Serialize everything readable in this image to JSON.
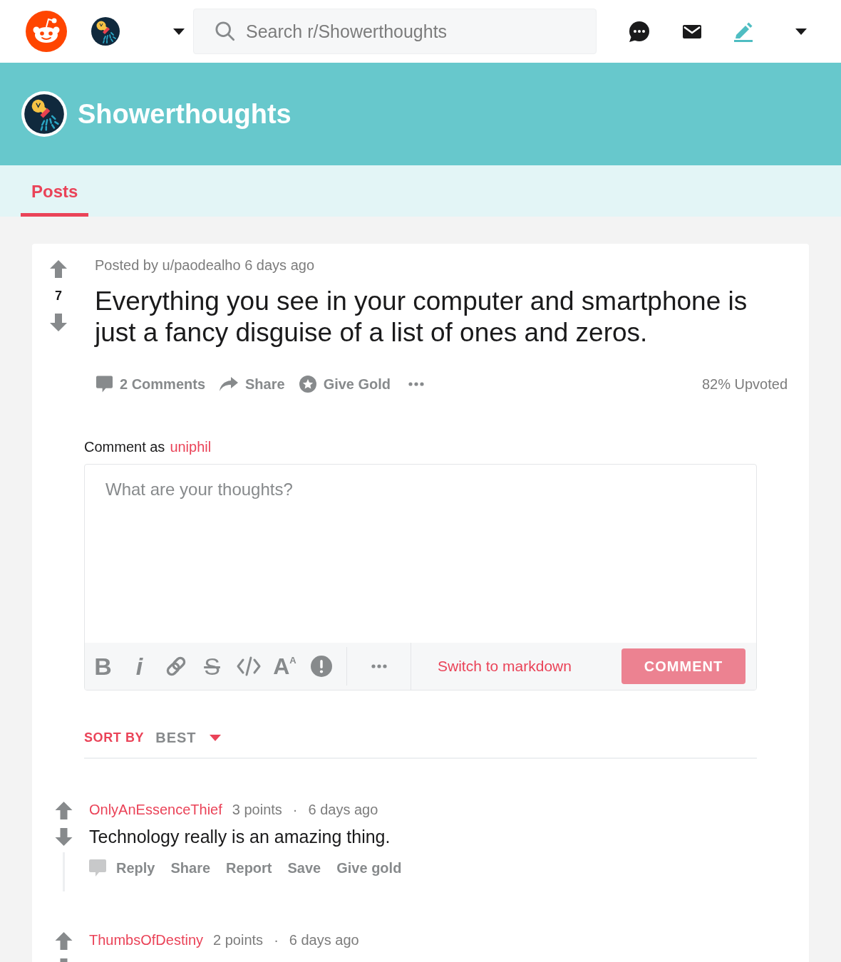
{
  "top_bar": {
    "search": {
      "placeholder": "Search r/Showerthoughts"
    }
  },
  "banner": {
    "title": "Showerthoughts"
  },
  "tabs": [
    {
      "label": "Posts",
      "selected": true
    }
  ],
  "post": {
    "score": "7",
    "byline": "Posted by u/paodealho 6 days ago",
    "title": "Everything you see in your computer and smartphone is just a fancy disguise of a list of ones and zeros.",
    "actions": [
      {
        "kind": "comments",
        "label": "2 Comments"
      },
      {
        "kind": "share",
        "label": "Share"
      },
      {
        "kind": "gold",
        "label": "Give Gold"
      },
      {
        "kind": "more"
      }
    ],
    "upvoted": "82% Upvoted"
  },
  "comment_form": {
    "label": "Comment as",
    "username": "uniphil",
    "placeholder": "What are your thoughts?",
    "tools": [
      {
        "kind": "bold",
        "glyph": "B"
      },
      {
        "kind": "italic",
        "glyph": "i"
      },
      {
        "kind": "link"
      },
      {
        "kind": "strikethrough",
        "glyph": "S"
      },
      {
        "kind": "code"
      },
      {
        "kind": "superscript",
        "glyph": "A$^{A}$"
      },
      {
        "kind": "spoiler"
      },
      {
        "kind": "more"
      }
    ],
    "switch_link": "Switch to markdown",
    "submit": {
      "label": "COMMENT",
      "disabled": true
    }
  },
  "sort": {
    "label": "SORT BY",
    "value": "BEST"
  },
  "comments": [
    {
      "author": "OnlyAnEssenceThief",
      "points": "3 points",
      "separator": "·",
      "time": "6 days ago",
      "body": "Technology really is an amazing thing.",
      "actions": [
        {
          "kind": "reply",
          "label": "Reply"
        },
        {
          "kind": "share",
          "label": "Share"
        },
        {
          "kind": "report",
          "label": "Report"
        },
        {
          "kind": "save",
          "label": "Save"
        },
        {
          "kind": "gold",
          "label": "Give gold"
        }
      ]
    },
    {
      "author": "ThumbsOfDestiny",
      "points": "2 points",
      "separator": "·",
      "time": "6 days ago"
    }
  ]
}
